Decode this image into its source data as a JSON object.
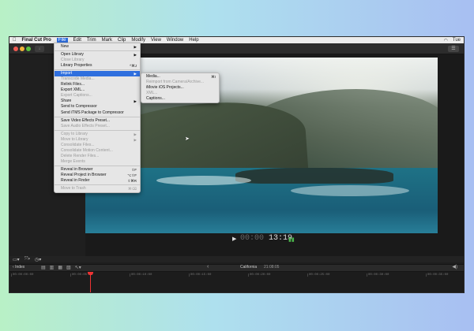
{
  "menubar": {
    "apple": "",
    "app": "Final Cut Pro",
    "items": [
      "File",
      "Edit",
      "Trim",
      "Mark",
      "Clip",
      "Modify",
      "View",
      "Window",
      "Help"
    ],
    "active": "File",
    "right": [
      "Tue"
    ]
  },
  "file_menu": {
    "items": [
      {
        "label": "New",
        "shortcut": "▶",
        "disabled": false
      },
      {
        "sep": true
      },
      {
        "label": "Open Library",
        "shortcut": "▶",
        "disabled": false
      },
      {
        "label": "Close Library",
        "shortcut": "",
        "disabled": true
      },
      {
        "label": "Library Properties",
        "shortcut": "^⌘J",
        "disabled": false
      },
      {
        "sep": true
      },
      {
        "label": "Import",
        "shortcut": "▶",
        "disabled": false,
        "highlighted": true
      },
      {
        "label": "Transcode Media...",
        "shortcut": "",
        "disabled": true
      },
      {
        "label": "Relink Files...",
        "shortcut": "",
        "disabled": false
      },
      {
        "label": "Export XML...",
        "shortcut": "",
        "disabled": false
      },
      {
        "label": "Export Captions...",
        "shortcut": "",
        "disabled": true
      },
      {
        "label": "Share",
        "shortcut": "▶",
        "disabled": false
      },
      {
        "label": "Send to Compressor",
        "shortcut": "",
        "disabled": false
      },
      {
        "label": "Send iTMS Package to Compressor",
        "shortcut": "",
        "disabled": false
      },
      {
        "sep": true
      },
      {
        "label": "Save Video Effects Preset...",
        "shortcut": "",
        "disabled": false
      },
      {
        "label": "Save Audio Effects Preset...",
        "shortcut": "",
        "disabled": true
      },
      {
        "sep": true
      },
      {
        "label": "Copy to Library",
        "shortcut": "▶",
        "disabled": true
      },
      {
        "label": "Move to Library",
        "shortcut": "▶",
        "disabled": true
      },
      {
        "label": "Consolidate Files...",
        "shortcut": "",
        "disabled": true
      },
      {
        "label": "Consolidate Motion Content...",
        "shortcut": "",
        "disabled": true
      },
      {
        "label": "Delete Render Files...",
        "shortcut": "",
        "disabled": true
      },
      {
        "label": "Merge Events",
        "shortcut": "",
        "disabled": true
      },
      {
        "sep": true
      },
      {
        "label": "Reveal in Browser",
        "shortcut": "⇧F",
        "disabled": false
      },
      {
        "label": "Reveal Project in Browser",
        "shortcut": "⌥⇧F",
        "disabled": false
      },
      {
        "label": "Reveal in Finder",
        "shortcut": "⇧⌘R",
        "disabled": false
      },
      {
        "sep": true
      },
      {
        "label": "Move to Trash",
        "shortcut": "⌘⌫",
        "disabled": true
      }
    ]
  },
  "import_submenu": {
    "items": [
      {
        "label": "Media...",
        "shortcut": "⌘I",
        "disabled": false
      },
      {
        "label": "Reimport from Camera/Archive...",
        "shortcut": "",
        "disabled": true
      },
      {
        "label": "iMovie iOS Projects...",
        "shortcut": "",
        "disabled": false
      },
      {
        "label": "XML...",
        "shortcut": "",
        "disabled": true
      },
      {
        "label": "Captions...",
        "shortcut": "",
        "disabled": false
      }
    ]
  },
  "viewer": {
    "timecode_dim": "00:00",
    "timecode": "13:19"
  },
  "timeline": {
    "index_label": "Index",
    "project_name": "California",
    "project_duration": "21:08:05",
    "ticks": [
      "00:00:00:00",
      "00:00:05:00",
      "00:00:10:00",
      "00:00:15:00",
      "00:00:20:00",
      "00:00:25:00",
      "00:00:30:00",
      "00:00:35:00"
    ]
  },
  "icons": {
    "close": "close-icon",
    "minimize": "minimize-icon",
    "zoom": "zoom-icon",
    "play": "play-icon",
    "volume": "volume-icon"
  }
}
